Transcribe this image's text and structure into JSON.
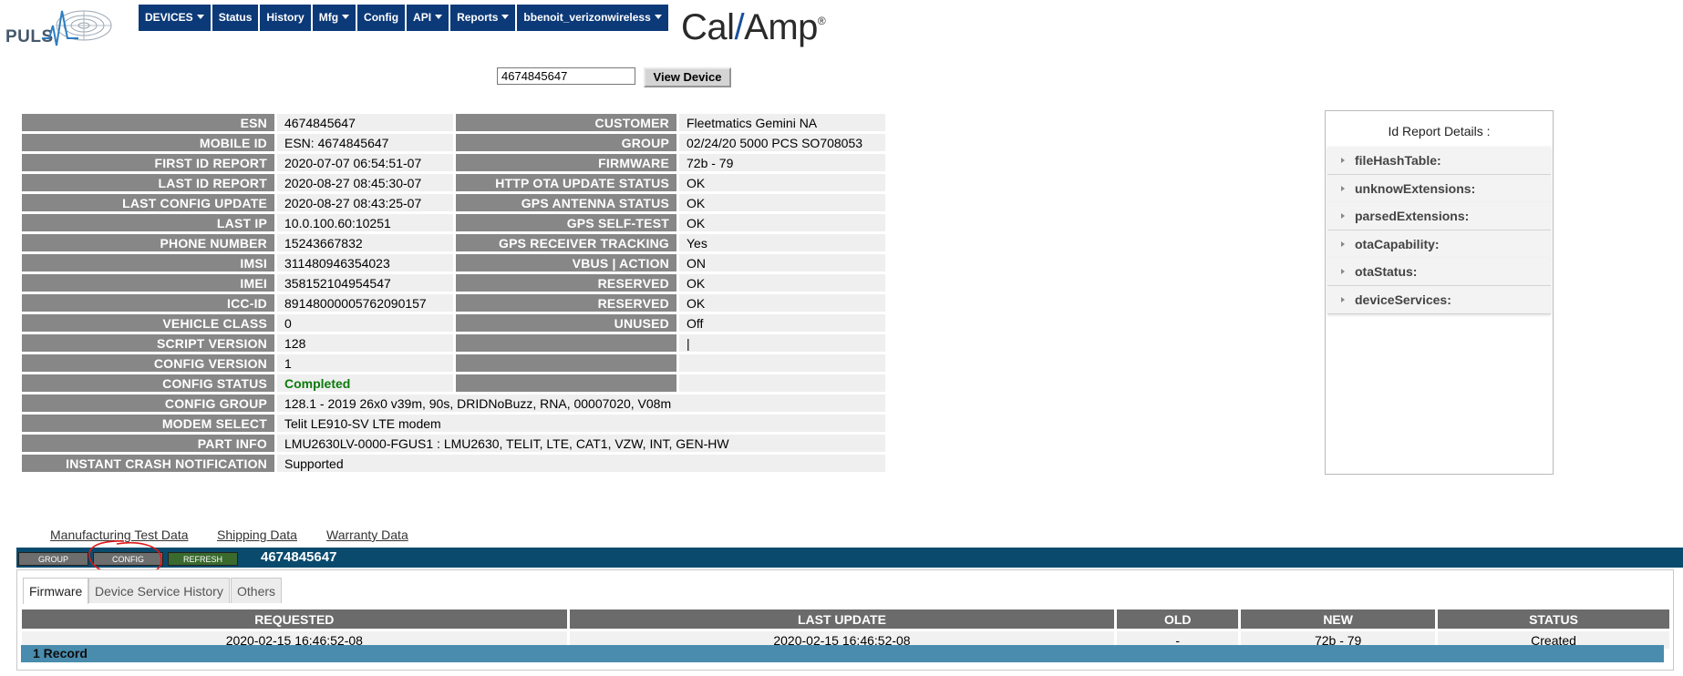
{
  "logo": {
    "text": "PULS"
  },
  "nav": {
    "items": [
      {
        "label": "DEVICES",
        "dropdown": true
      },
      {
        "label": "Status",
        "dropdown": false
      },
      {
        "label": "History",
        "dropdown": false
      },
      {
        "label": "Mfg",
        "dropdown": true
      },
      {
        "label": "Config",
        "dropdown": false
      },
      {
        "label": "API",
        "dropdown": true
      },
      {
        "label": "Reports",
        "dropdown": true
      },
      {
        "label": "bbenoit_verizonwireless",
        "dropdown": true
      }
    ]
  },
  "brand": {
    "left": "Cal",
    "slash": "/",
    "right": "Amp",
    "reg": "®"
  },
  "search": {
    "value": "4674845647",
    "button": "View Device"
  },
  "info": {
    "rows": [
      {
        "l1": "ESN",
        "v1": "4674845647",
        "l2": "CUSTOMER",
        "v2": "Fleetmatics Gemini NA"
      },
      {
        "l1": "MOBILE ID",
        "v1": "ESN: 4674845647",
        "l2": "GROUP",
        "v2": "02/24/20 5000 PCS SO708053"
      },
      {
        "l1": "FIRST ID REPORT",
        "v1": "2020-07-07 06:54:51-07",
        "l2": "FIRMWARE",
        "v2": "72b - 79"
      },
      {
        "l1": "LAST ID REPORT",
        "v1": "2020-08-27 08:45:30-07",
        "l2": "HTTP OTA UPDATE STATUS",
        "v2": "OK"
      },
      {
        "l1": "LAST CONFIG UPDATE",
        "v1": "2020-08-27 08:43:25-07",
        "l2": "GPS ANTENNA STATUS",
        "v2": "OK"
      },
      {
        "l1": "LAST IP",
        "v1": "10.0.100.60:10251",
        "l2": "GPS SELF-TEST",
        "v2": "OK"
      },
      {
        "l1": "PHONE NUMBER",
        "v1": "15243667832",
        "l2": "GPS RECEIVER TRACKING",
        "v2": "Yes"
      },
      {
        "l1": "IMSI",
        "v1": "311480946354023",
        "l2": "VBUS | ACTION",
        "v2": "ON"
      },
      {
        "l1": "IMEI",
        "v1": "358152104954547",
        "l2": "RESERVED",
        "v2": "OK"
      },
      {
        "l1": "ICC-ID",
        "v1": "89148000005762090157",
        "l2": "RESERVED",
        "v2": "OK"
      },
      {
        "l1": "VEHICLE CLASS",
        "v1": "0",
        "l2": "UNUSED",
        "v2": "Off"
      },
      {
        "l1": "SCRIPT VERSION",
        "v1": "128",
        "l2": "",
        "v2": "|"
      },
      {
        "l1": "CONFIG VERSION",
        "v1": "1",
        "l2": "",
        "v2": ""
      },
      {
        "l1": "CONFIG STATUS",
        "v1": "Completed",
        "l2": "",
        "v2": ""
      }
    ],
    "wide_rows": [
      {
        "l": "CONFIG GROUP",
        "v": "128.1 - 2019 26x0 v39m, 90s, DRIDNoBuzz, RNA, 00007020, V08m"
      },
      {
        "l": "MODEM SELECT",
        "v": "Telit LE910-SV LTE modem"
      },
      {
        "l": "PART INFO",
        "v": "LMU2630LV-0000-FGUS1 : LMU2630, TELIT, LTE, CAT1, VZW, INT, GEN-HW"
      },
      {
        "l": "INSTANT CRASH NOTIFICATION",
        "v": "Supported"
      }
    ]
  },
  "links": {
    "mfg": "Manufacturing Test Data",
    "ship": "Shipping Data",
    "warranty": "Warranty Data"
  },
  "bar": {
    "group": "GROUP",
    "config": "CONFIG",
    "refresh": "REFRESH",
    "title": "4674845647"
  },
  "tabs": [
    "Firmware",
    "Device Service History",
    "Others"
  ],
  "firmware_table": {
    "headers": [
      "REQUESTED",
      "LAST UPDATE",
      "OLD",
      "NEW",
      "STATUS"
    ],
    "row": [
      "2020-02-15 16:46:52-08",
      "2020-02-15 16:46:52-08",
      "-",
      "72b - 79",
      "Created"
    ],
    "records": "1 Record"
  },
  "report": {
    "title": "Id Report Details :",
    "items": [
      "fileHashTable:",
      "unknowExtensions:",
      "parsedExtensions:",
      "otaCapability:",
      "otaStatus:",
      "deviceServices:"
    ]
  },
  "colors": {
    "nav": "#0c3a78",
    "bar": "#0a4b6d",
    "label": "#878787",
    "status_ok": "#0b7a0b",
    "annotation": "#e01818"
  }
}
